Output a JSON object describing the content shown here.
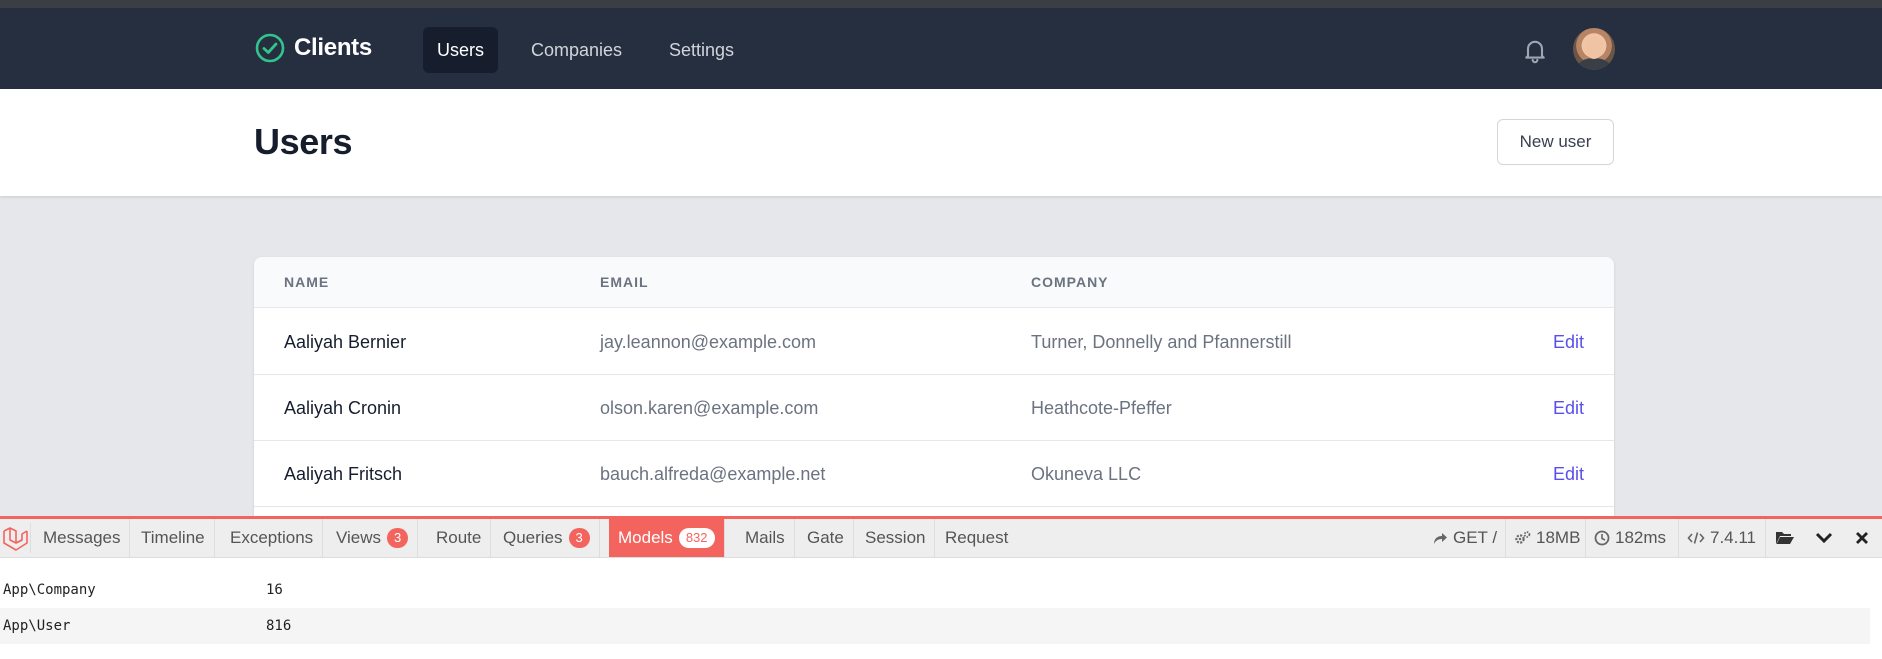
{
  "app": {
    "brand": "Clients",
    "nav": [
      "Users",
      "Companies",
      "Settings"
    ]
  },
  "header": {
    "title": "Users",
    "new_button": "New user"
  },
  "table": {
    "columns": [
      "NAME",
      "EMAIL",
      "COMPANY"
    ],
    "edit_label": "Edit",
    "rows": [
      {
        "name": "Aaliyah Bernier",
        "email": "jay.leannon@example.com",
        "company": "Turner, Donnelly and Pfannerstill"
      },
      {
        "name": "Aaliyah Cronin",
        "email": "olson.karen@example.com",
        "company": "Heathcote-Pfeffer"
      },
      {
        "name": "Aaliyah Fritsch",
        "email": "bauch.alfreda@example.net",
        "company": "Okuneva LLC"
      }
    ]
  },
  "debugbar": {
    "tabs": [
      {
        "label": "Messages",
        "badge": ""
      },
      {
        "label": "Timeline",
        "badge": ""
      },
      {
        "label": "Exceptions",
        "badge": ""
      },
      {
        "label": "Views",
        "badge": "3"
      },
      {
        "label": "Route",
        "badge": ""
      },
      {
        "label": "Queries",
        "badge": "3"
      },
      {
        "label": "Models",
        "badge": "832"
      },
      {
        "label": "Mails",
        "badge": ""
      },
      {
        "label": "Gate",
        "badge": ""
      },
      {
        "label": "Session",
        "badge": ""
      },
      {
        "label": "Request",
        "badge": ""
      }
    ],
    "active_tab": "Models",
    "method": "GET",
    "route": "/",
    "memory": "18MB",
    "time": "182ms",
    "php_version": "7.4.11",
    "models": [
      {
        "model": "App\\Company",
        "count": "16"
      },
      {
        "model": "App\\User",
        "count": "816"
      }
    ]
  },
  "colors": {
    "nav_bg": "#252f3f",
    "accent": "#5850ec",
    "brand_icon": "#31c48d",
    "debug_accent": "#f4645f"
  }
}
